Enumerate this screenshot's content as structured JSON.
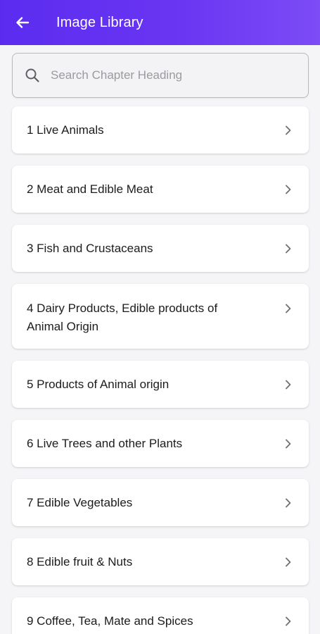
{
  "appbar": {
    "title": "Image Library",
    "back_icon": "arrow-left-icon",
    "gradient_start": "#5b2cf0",
    "gradient_end": "#7c4cf6"
  },
  "search": {
    "placeholder": "Search Chapter Heading",
    "value": "",
    "icon": "search-icon"
  },
  "chapters": [
    {
      "label": "1 Live Animals"
    },
    {
      "label": "2 Meat and Edible Meat"
    },
    {
      "label": "3 Fish and Crustaceans"
    },
    {
      "label": "4 Dairy Products, Edible products of Animal Origin"
    },
    {
      "label": "5 Products of Animal origin"
    },
    {
      "label": "6 Live Trees and other Plants"
    },
    {
      "label": "7 Edible Vegetables"
    },
    {
      "label": "8 Edible fruit & Nuts"
    },
    {
      "label": "9 Coffee, Tea, Mate and Spices"
    }
  ]
}
